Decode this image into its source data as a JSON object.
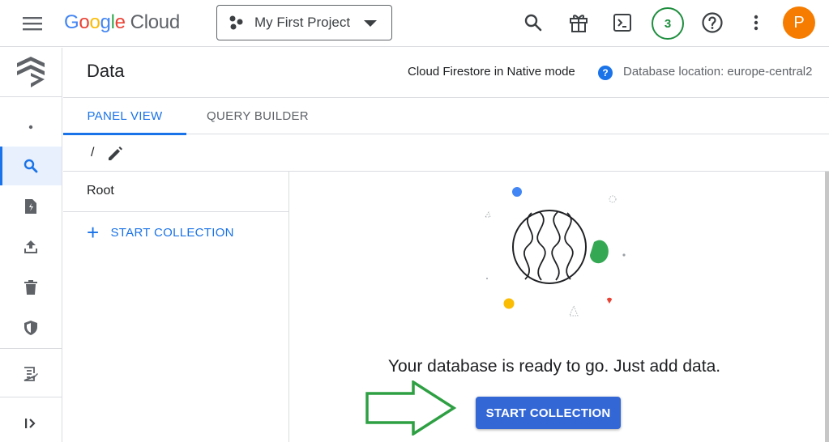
{
  "topbar": {
    "logo_google": [
      "G",
      "o",
      "o",
      "g",
      "l",
      "e"
    ],
    "logo_cloud": "Cloud",
    "project_name": "My First Project",
    "notifications_count": "3",
    "avatar_letter": "P"
  },
  "leftnav": {
    "items": [
      {
        "icon": "dot-icon"
      },
      {
        "icon": "search-icon",
        "active": true
      },
      {
        "icon": "import-export-icon"
      },
      {
        "icon": "upload-icon"
      },
      {
        "icon": "trash-icon"
      },
      {
        "icon": "shield-icon"
      },
      {
        "icon": "notes-icon"
      },
      {
        "icon": "expand-icon"
      }
    ]
  },
  "header": {
    "title": "Data",
    "mode": "Cloud Firestore in Native mode",
    "help": "?",
    "location": "Database location: europe-central2"
  },
  "tabs": [
    {
      "label": "PANEL VIEW",
      "active": true
    },
    {
      "label": "QUERY BUILDER",
      "active": false
    }
  ],
  "path": {
    "current": "/"
  },
  "root_panel": {
    "title": "Root",
    "start_link_plus": "+",
    "start_link_label": "START COLLECTION"
  },
  "empty_state": {
    "message": "Your database is ready to go. Just add data.",
    "button_label": "START COLLECTION"
  },
  "colors": {
    "accent": "#1a73e8",
    "button": "#3367d6",
    "avatar": "#f57c00",
    "badge": "#1e8e3e",
    "annotation_arrow": "#2ea043"
  }
}
